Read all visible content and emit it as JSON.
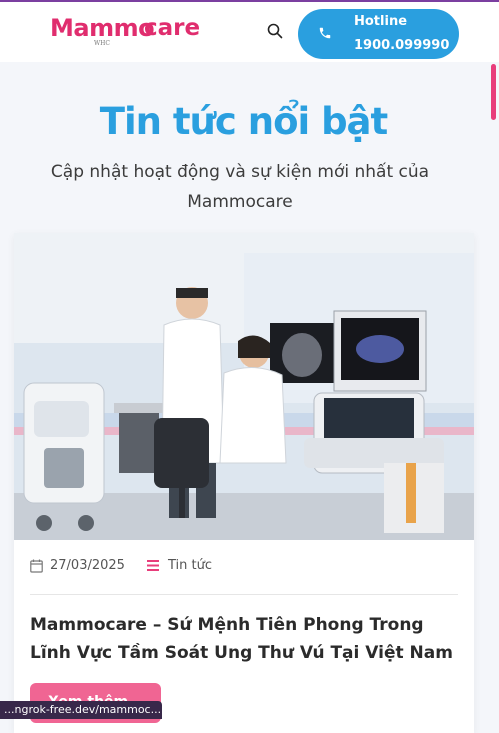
{
  "header": {
    "logo_main": "Mammo",
    "logo_care": "care",
    "logo_tag": "WHC",
    "hotline_label": "Hotline",
    "hotline_number": "1900.099990"
  },
  "section": {
    "title": "Tin tức nổi bật",
    "subtitle": "Cập nhật hoạt động và sự kiện mới nhất của Mammocare"
  },
  "article": {
    "date": "27/03/2025",
    "category": "Tin tức",
    "title": "Mammocare – Sứ Mệnh Tiên Phong Trong Lĩnh Vực Tầm Soát Ung Thư Vú Tại Việt Nam",
    "more_label": "Xem thêm"
  },
  "status_bar": {
    "url": "...ngrok-free.dev/mammoc..."
  },
  "colors": {
    "brand_pink": "#e02d6e",
    "brand_blue": "#2a9fdf",
    "button_pink": "#f06593"
  },
  "icons": [
    "search-icon",
    "phone-icon",
    "calendar-icon",
    "menu-lines-icon",
    "arrow-right-icon"
  ]
}
